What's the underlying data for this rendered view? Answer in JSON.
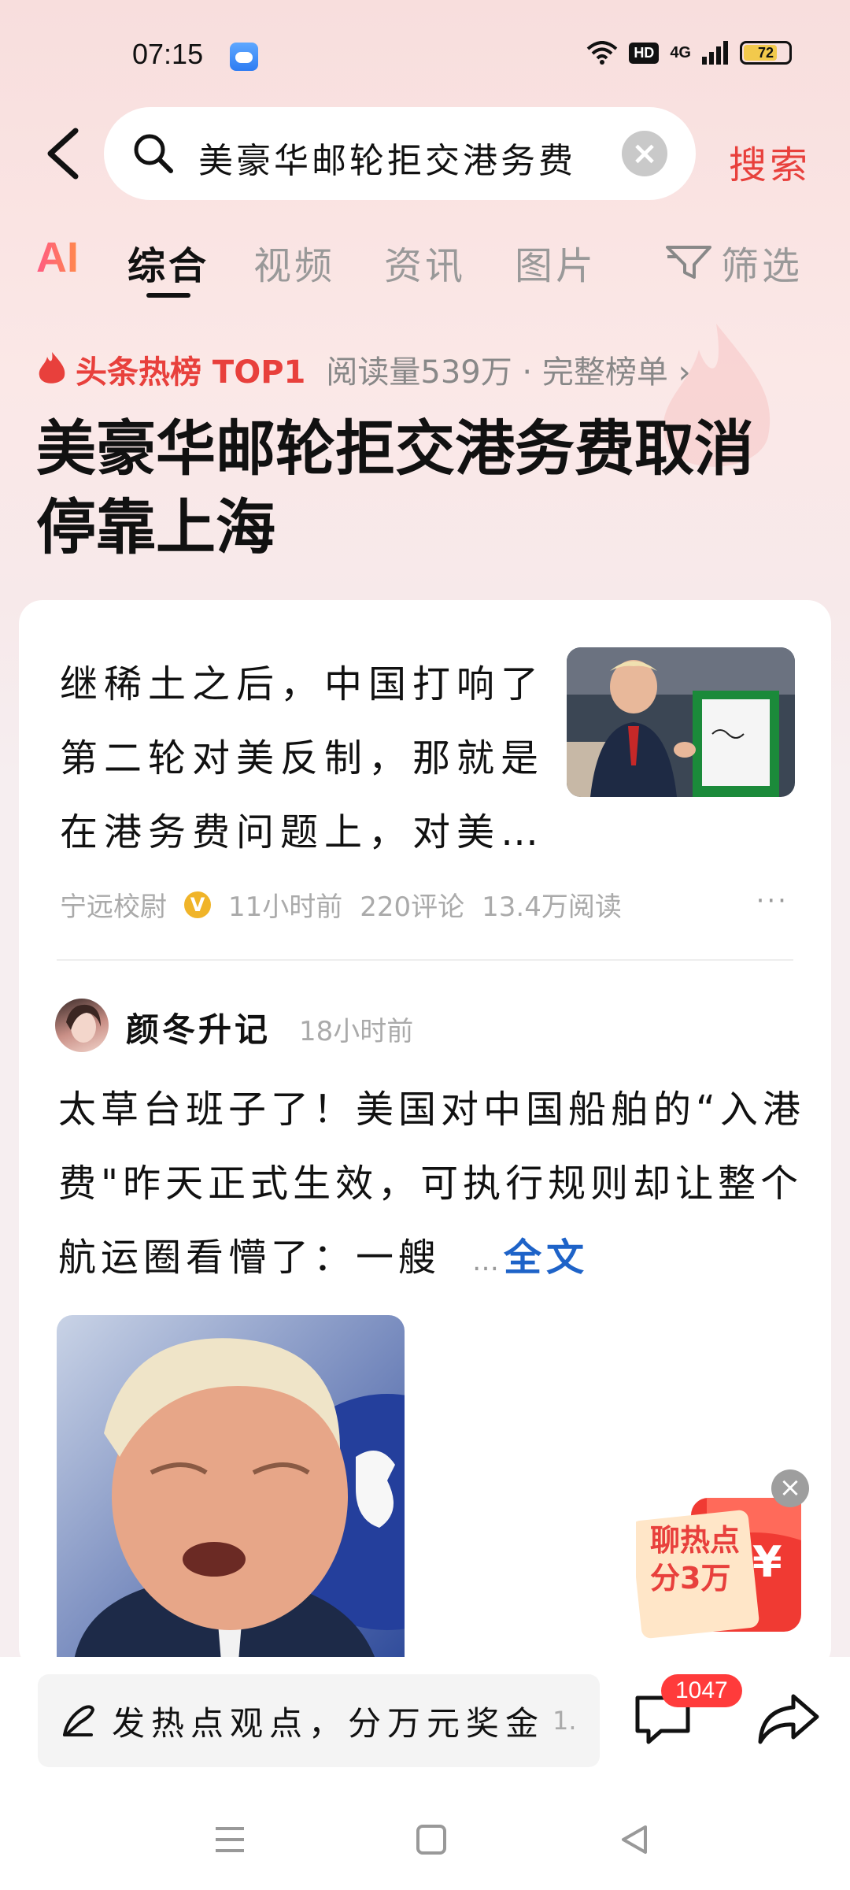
{
  "status_bar": {
    "time": "07:15",
    "hd": "HD",
    "network": "4G",
    "battery": "72"
  },
  "search": {
    "query": "美豪华邮轮拒交港务费",
    "button": "搜索"
  },
  "tabs": {
    "ai": "AI",
    "items": [
      "综合",
      "视频",
      "资讯",
      "图片"
    ],
    "filter": "筛选",
    "active": "综合"
  },
  "hot": {
    "rank": "头条热榜 TOP1",
    "meta": "阅读量539万 · 完整榜单 ›",
    "headline": "美豪华邮轮拒交港务费取消停靠上海"
  },
  "article1": {
    "text": "继稀土之后，中国打响了第二轮对美反制，那就是在港务费问题上，对美…",
    "author": "宁远校尉",
    "time": "11小时前",
    "comments": "220评论",
    "reads": "13.4万阅读",
    "more": "···"
  },
  "article2": {
    "author": "颜冬升记",
    "time": "18小时前",
    "text": "太草台班子了！美国对中国船舶的“入港费\"昨天正式生效，可执行规则却让整个航运圈看懵了：一艘",
    "ellipsis": "…",
    "fulltext": "全文"
  },
  "promo": {
    "line1": "聊热点",
    "line2": "分3万",
    "symbol": "¥"
  },
  "bottom": {
    "placeholder": "发热点观点，分万元奖金",
    "placeholder_tail": "1.",
    "comment_count": "1047"
  },
  "colors": {
    "accent": "#e8403c",
    "link": "#1e63c8"
  }
}
